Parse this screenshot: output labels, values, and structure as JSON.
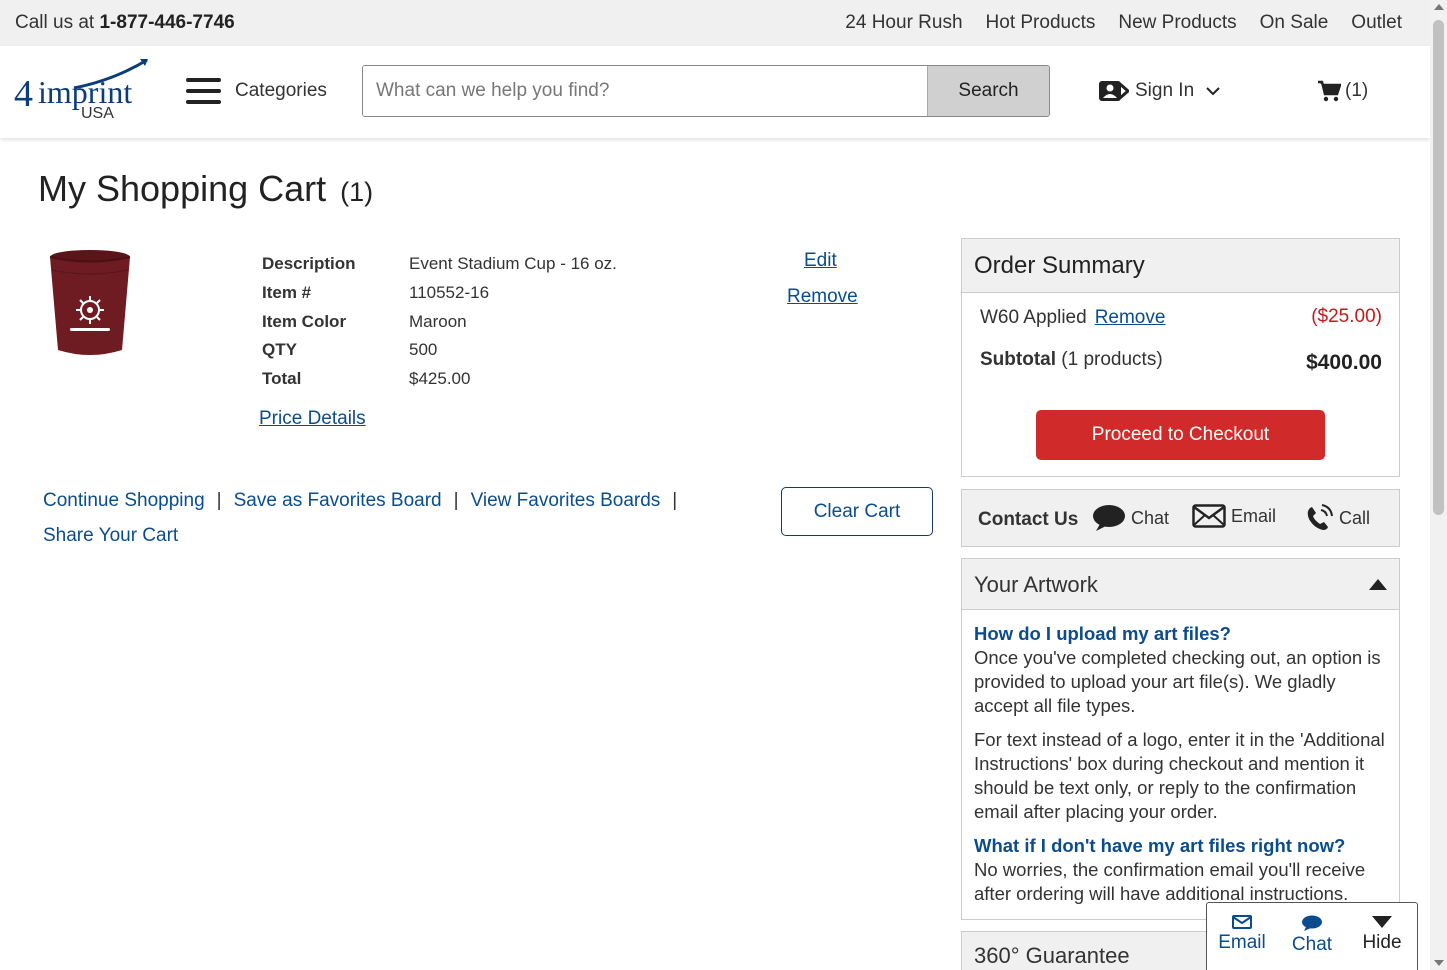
{
  "topbar": {
    "call_prefix": "Call us at",
    "phone": "1-877-446-7746",
    "nav": [
      "24 Hour Rush",
      "Hot Products",
      "New Products",
      "On Sale",
      "Outlet"
    ]
  },
  "header": {
    "logo_text": "imprint",
    "logo_number": "4",
    "logo_country": "USA",
    "categories_label": "Categories",
    "search_placeholder": "What can we help you find?",
    "search_button": "Search",
    "sign_in": "Sign In",
    "cart_count": "(1)"
  },
  "page": {
    "title": "My Shopping Cart",
    "count": "(1)"
  },
  "item": {
    "image_icon": "cup-icon",
    "image_color": "#6e1b22",
    "rows": [
      {
        "label": "Description",
        "value": "Event Stadium Cup - 16 oz."
      },
      {
        "label": "Item #",
        "value": "110552-16"
      },
      {
        "label": "Item Color",
        "value": "Maroon"
      },
      {
        "label": "QTY",
        "value": "500"
      },
      {
        "label": "Total",
        "value": "$425.00"
      }
    ],
    "price_details": "Price Details",
    "edit": "Edit",
    "remove": "Remove"
  },
  "actions": {
    "continue": "Continue Shopping",
    "save_board": "Save as Favorites Board",
    "view_boards": "View Favorites Boards",
    "share": "Share Your Cart",
    "separator": "|",
    "clear": "Clear Cart"
  },
  "summary": {
    "title": "Order Summary",
    "discount_label": "W60 Applied",
    "discount_remove": "Remove",
    "discount_value": "($25.00)",
    "subtotal_label": "Subtotal",
    "subtotal_products": "(1 products)",
    "subtotal_value": "$400.00",
    "checkout": "Proceed to Checkout"
  },
  "contact": {
    "title": "Contact Us",
    "chat": "Chat",
    "email": "Email",
    "call": "Call"
  },
  "artwork": {
    "title": "Your Artwork",
    "q1": "How do I upload my art files?",
    "a1": "Once you've completed checking out, an option is provided to upload your art file(s). We gladly accept all file types.",
    "a1b": "For text instead of a logo, enter it in the 'Additional Instructions' box during checkout and mention it should be text only, or reply to the confirmation email after placing your order.",
    "q2": "What if I don't have my art files right now?",
    "a2": "No worries, the confirmation email you'll receive after ordering will have additional instructions."
  },
  "guarantee": {
    "title": "360° Guarantee"
  },
  "widget": {
    "email": "Email",
    "chat": "Chat",
    "hide": "Hide"
  },
  "colors": {
    "accent": "#0b4d8c",
    "checkout": "#d12a2a",
    "discount": "#c21b1b"
  }
}
